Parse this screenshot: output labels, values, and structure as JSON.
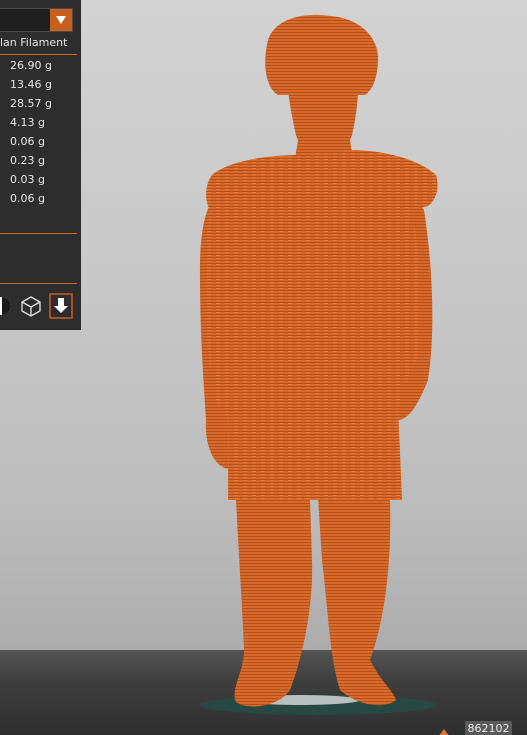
{
  "panel": {
    "filament_name": "lan Filament",
    "weights": [
      "26.90 g",
      "13.46 g",
      "28.57 g",
      "4.13 g",
      "0.06 g",
      "0.23 g",
      "0.03 g",
      "0.06 g"
    ]
  },
  "view_buttons": [
    "half-circle-icon",
    "cube-outline-icon",
    "layer-down-icon"
  ],
  "status": {
    "count": "862102"
  },
  "colors": {
    "model": "#d9692a",
    "accent": "#c85f1d",
    "panel": "#2d2d2d"
  }
}
